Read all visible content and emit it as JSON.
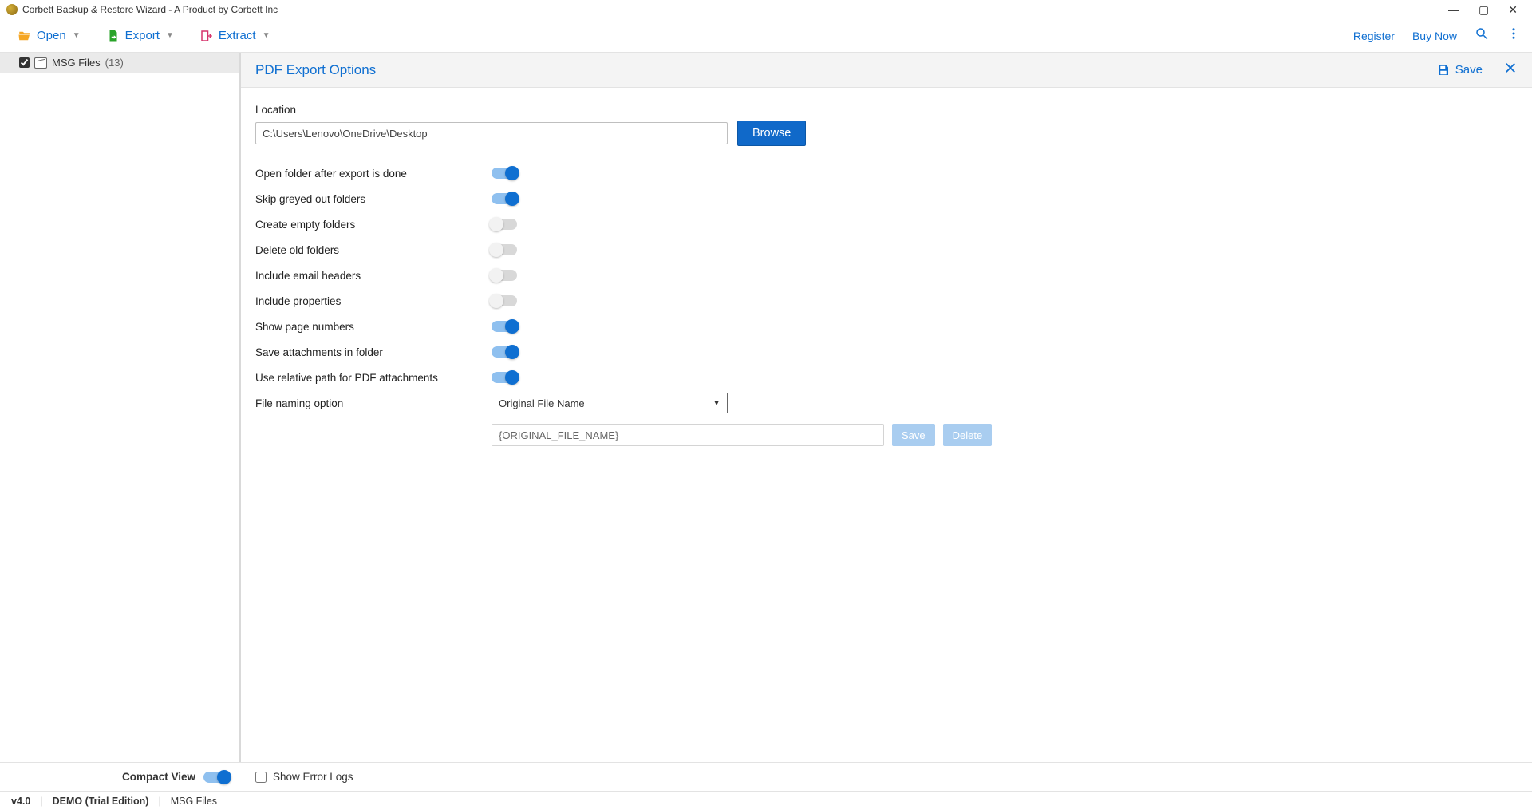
{
  "window": {
    "title": "Corbett Backup & Restore Wizard - A Product by Corbett Inc"
  },
  "toolbar": {
    "open_label": "Open",
    "export_label": "Export",
    "extract_label": "Extract",
    "register_label": "Register",
    "buy_now_label": "Buy Now"
  },
  "sidebar": {
    "items": [
      {
        "label": "MSG Files",
        "count": "(13)",
        "checked": true
      }
    ],
    "compact_view_label": "Compact View",
    "compact_view_on": true
  },
  "panel": {
    "title": "PDF Export Options",
    "save_label": "Save",
    "location_label": "Location",
    "location_value": "C:\\Users\\Lenovo\\OneDrive\\Desktop",
    "browse_label": "Browse",
    "options": [
      {
        "label": "Open folder after export is done",
        "on": true
      },
      {
        "label": "Skip greyed out folders",
        "on": true
      },
      {
        "label": "Create empty folders",
        "on": false
      },
      {
        "label": "Delete old folders",
        "on": false
      },
      {
        "label": "Include email headers",
        "on": false
      },
      {
        "label": "Include properties",
        "on": false
      },
      {
        "label": "Show page numbers",
        "on": true
      },
      {
        "label": "Save attachments in folder",
        "on": true
      },
      {
        "label": "Use relative path for PDF attachments",
        "on": true
      }
    ],
    "file_naming_label": "File naming option",
    "file_naming_value": "Original File Name",
    "pattern_value": "{ORIGINAL_FILE_NAME}",
    "pattern_save_label": "Save",
    "pattern_delete_label": "Delete",
    "show_error_logs_label": "Show Error Logs"
  },
  "status": {
    "version": "v4.0",
    "edition": "DEMO (Trial Edition)",
    "context": "MSG Files"
  }
}
